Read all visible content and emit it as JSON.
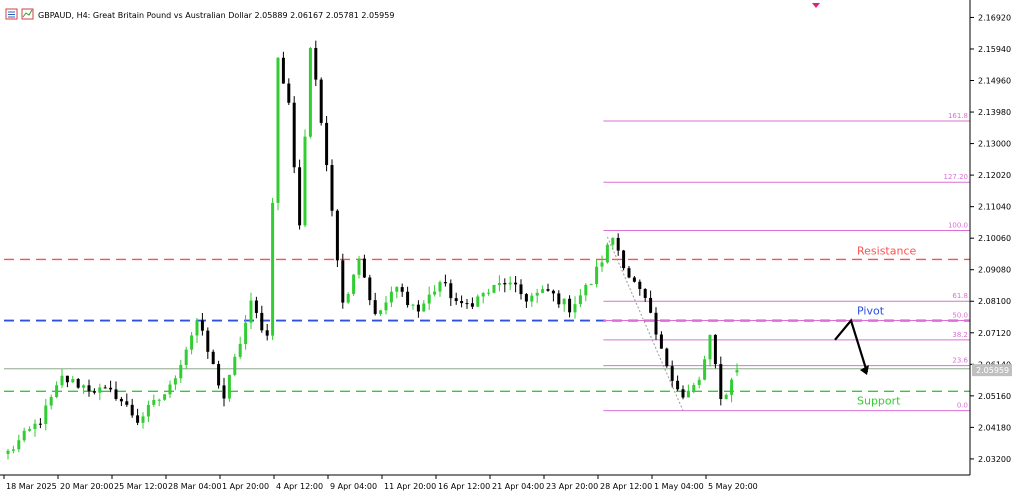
{
  "window": {
    "title": "GBPAUD, H4:  Great Britain Pound vs Australian Dollar  2.05889 2.06167 2.05781 2.05959",
    "icons": [
      "chart-list-icon",
      "chart-indicator-icon"
    ]
  },
  "colors": {
    "bull": "#32cd32",
    "bear": "#000000",
    "resistance": "#ff5050",
    "pivot": "#3050e0",
    "support": "#32cd32",
    "fib": "#da70d6",
    "axis": "#000000",
    "price_marker": "#c0c0c0",
    "arrow": "#000000",
    "top_marker": "#e0207f"
  },
  "chart_data": {
    "type": "candlestick",
    "symbol": "GBPAUD",
    "timeframe": "H4",
    "title": "GBPAUD, H4:  Great Britain Pound vs Australian Dollar  2.05889 2.06167 2.05781 2.05959",
    "ohlc_last": {
      "open": 2.05889,
      "high": 2.06167,
      "low": 2.05781,
      "close": 2.05959
    },
    "current_price_label": "2.05959",
    "ylim": [
      2.027,
      2.174
    ],
    "y_ticks": [
      "2.16920",
      "2.15940",
      "2.14960",
      "2.13980",
      "2.13000",
      "2.12020",
      "2.11040",
      "2.10060",
      "2.09080",
      "2.08100",
      "2.07120",
      "2.06140",
      "2.05160",
      "2.04180",
      "2.03200"
    ],
    "y_tick_values": [
      2.1692,
      2.1594,
      2.1496,
      2.1398,
      2.13,
      2.1202,
      2.1104,
      2.1006,
      2.0908,
      2.081,
      2.0712,
      2.0614,
      2.0516,
      2.0418,
      2.032
    ],
    "x_ticks": [
      "18 Mar 2025",
      "20 Mar 20:00",
      "25 Mar 12:00",
      "28 Mar 04:00",
      "1 Apr 20:00",
      "4 Apr 12:00",
      "9 Apr 04:00",
      "11 Apr 20:00",
      "16 Apr 12:00",
      "21 Apr 04:00",
      "23 Apr 20:00",
      "28 Apr 12:00",
      "1 May 04:00",
      "5 May 20:00"
    ],
    "x_tick_bar_index": [
      0,
      10,
      20,
      30,
      40,
      50,
      60,
      70,
      80,
      90,
      100,
      110,
      120,
      130
    ],
    "bar_count": 136,
    "path": [
      [
        0,
        2.034
      ],
      [
        6,
        2.044
      ],
      [
        10,
        2.057
      ],
      [
        15,
        2.054
      ],
      [
        20,
        2.052
      ],
      [
        24,
        2.044
      ],
      [
        30,
        2.054
      ],
      [
        35,
        2.075
      ],
      [
        40,
        2.051
      ],
      [
        45,
        2.08
      ],
      [
        48,
        2.07
      ],
      [
        50,
        2.156
      ],
      [
        52,
        2.142
      ],
      [
        54,
        2.105
      ],
      [
        56,
        2.16
      ],
      [
        59,
        2.125
      ],
      [
        62,
        2.08
      ],
      [
        65,
        2.095
      ],
      [
        68,
        2.076
      ],
      [
        72,
        2.085
      ],
      [
        76,
        2.078
      ],
      [
        80,
        2.087
      ],
      [
        84,
        2.079
      ],
      [
        88,
        2.083
      ],
      [
        92,
        2.087
      ],
      [
        96,
        2.082
      ],
      [
        100,
        2.084
      ],
      [
        104,
        2.079
      ],
      [
        108,
        2.087
      ],
      [
        112,
        2.101
      ],
      [
        115,
        2.089
      ],
      [
        118,
        2.081
      ],
      [
        121,
        2.065
      ],
      [
        125,
        2.051
      ],
      [
        128,
        2.056
      ],
      [
        130,
        2.07
      ],
      [
        132,
        2.05
      ],
      [
        135,
        2.0596
      ]
    ],
    "horizontal_levels": [
      {
        "name": "Resistance",
        "value": 2.094,
        "style": "dashed"
      },
      {
        "name": "Pivot",
        "value": 2.075,
        "style": "dashed"
      },
      {
        "name": "Support",
        "value": 2.053,
        "style": "dashed"
      },
      {
        "name": "price-line",
        "value": 2.06,
        "style": "solid"
      }
    ],
    "fibonacci": {
      "start_bar": 111,
      "levels": [
        {
          "label": "161.8",
          "value": 2.137
        },
        {
          "label": "127.20",
          "value": 2.118
        },
        {
          "label": "100.0",
          "value": 2.103
        },
        {
          "label": "61.8",
          "value": 2.081
        },
        {
          "label": "50.0",
          "value": 2.075
        },
        {
          "label": "38.2",
          "value": 2.069
        },
        {
          "label": "23.6",
          "value": 2.061
        },
        {
          "label": "0.0",
          "value": 2.047
        }
      ]
    },
    "annotations": [
      {
        "text": "Resistance",
        "color_key": "resistance"
      },
      {
        "text": "Pivot",
        "color_key": "pivot"
      },
      {
        "text": "Support",
        "color_key": "support"
      }
    ],
    "projection_arrow": {
      "points": [
        [
          2.069,
          0
        ],
        [
          2.075,
          1
        ],
        [
          2.059,
          2
        ]
      ]
    }
  }
}
